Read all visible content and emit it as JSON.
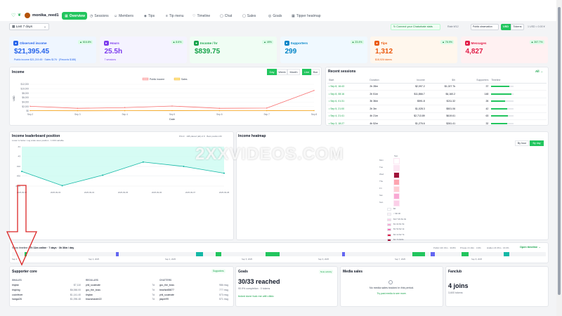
{
  "nav": {
    "username": "monika_reed1",
    "tabs": [
      {
        "label": "Overview",
        "icon": "grid-icon"
      },
      {
        "label": "Sessions",
        "icon": "clock-icon"
      },
      {
        "label": "Members",
        "icon": "users-icon"
      },
      {
        "label": "Tips",
        "icon": "coin-icon"
      },
      {
        "label": "Tip menu",
        "icon": "list-icon"
      },
      {
        "label": "Timeline",
        "icon": "timeline-icon"
      },
      {
        "label": "Chat",
        "icon": "chat-icon"
      },
      {
        "label": "Sales",
        "icon": "cart-icon"
      },
      {
        "label": "Goals",
        "icon": "target-icon"
      },
      {
        "label": "Tipper heatmap",
        "icon": "grid-icon"
      }
    ]
  },
  "toolbar": {
    "range": "Last 7 days",
    "connect": "Connect your Chaturbate stats",
    "rate_label": "Rate ¥/12",
    "rate_value": "Public observation",
    "currency_usd": "USD",
    "currency_tokens": "Tokens",
    "exchange": "1 USD = 0.00 ¥"
  },
  "kpis": [
    {
      "label": "Observed income",
      "value": "$21,395.45",
      "badge": "▲ 616.8%",
      "sub": "Public income $21,219.45 · Sales $176 · (Records $188)",
      "color": "#2563eb",
      "bg": "#eff6ff"
    },
    {
      "label": "Hours",
      "value": "25.5h",
      "badge": "▲ 8.6%",
      "sub": "7 sessions",
      "color": "#7c3aed",
      "bg": "#f5f3ff"
    },
    {
      "label": "Income / hr",
      "value": "$839.75",
      "badge": "▲ 49%",
      "sub": "",
      "color": "#16a34a",
      "bg": "#f0fdf4"
    },
    {
      "label": "Supporters",
      "value": "299",
      "badge": "▲ 23.4%",
      "sub": "",
      "color": "#0284c7",
      "bg": "#f0f9ff"
    },
    {
      "label": "Tips",
      "value": "1,312",
      "badge": "▲ 76.9%",
      "sub": "$18,926 tokens",
      "color": "#ea580c",
      "bg": "#fff7ed"
    },
    {
      "label": "Messages",
      "value": "4,827",
      "badge": "▲ 267.7%",
      "sub": "",
      "color": "#e11d48",
      "bg": "#fff1f2"
    }
  ],
  "income_card": {
    "title": "Income",
    "buttons": [
      "Day",
      "Week",
      "Month",
      "Line",
      "Bar"
    ],
    "legend": [
      "Public income",
      "Sales"
    ],
    "xlabel": "Date",
    "ylabel": "USD"
  },
  "chart_data": {
    "type": "line",
    "title": "Income",
    "xlabel": "Date",
    "ylabel": "USD",
    "categories": [
      "Sep 2",
      "Sep 3",
      "Sep 4",
      "Sep 5",
      "Sep 6",
      "Sep 7",
      "Sep 8"
    ],
    "series": [
      {
        "name": "Public income",
        "values": [
          2100,
          1200,
          1500,
          2200,
          1200,
          1300,
          9200
        ],
        "color": "#f87171"
      },
      {
        "name": "Sales",
        "values": [
          150,
          100,
          120,
          140,
          110,
          130,
          160
        ],
        "color": "#f59e0b"
      }
    ],
    "yticks": [
      "$0",
      "$2,000",
      "$4,000",
      "$6,000",
      "$8,000",
      "$10,000",
      "$12,000"
    ],
    "ylim": [
      0,
      12000
    ]
  },
  "sessions": {
    "title": "Recent sessions",
    "all": "All →",
    "columns": [
      "Start",
      "Duration",
      "Income",
      "$/h",
      "Supporters",
      "Timeline"
    ],
    "rows": [
      {
        "start": "Sep 8, 16:43",
        "duration": "2h 28m",
        "income": "$2,097.2",
        "rate": "$1,027.7k",
        "supporters": "37",
        "fill": 0.8
      },
      {
        "start": "Sep 8, 08:16",
        "duration": "2h 51m",
        "income": "$11,866.7",
        "rate": "$4,160.2",
        "supporters": "148",
        "fill": 0.9
      },
      {
        "start": "Sep 6, 01:31",
        "duration": "3h 36m",
        "income": "$591.8",
        "rate": "$211.32",
        "supporters": "26",
        "fill": 0.6
      },
      {
        "start": "Sep 5, 21:00",
        "duration": "2h 3m",
        "income": "$1,028.3",
        "rate": "$501.06",
        "supporters": "42",
        "fill": 0.7
      },
      {
        "start": "Sep 4, 21:41",
        "duration": "4h 21m",
        "income": "$2,713.89",
        "rate": "$619.61",
        "supporters": "63",
        "fill": 0.75
      },
      {
        "start": "Sep 3, 18:27",
        "duration": "4h 52m",
        "income": "$1,276.6",
        "rate": "$261.41",
        "supporters": "32",
        "fill": 0.7
      }
    ]
  },
  "leaderboard": {
    "title": "Income leaderboard position",
    "subtitle": "Lower is better. Log scale axes position · 1 000 variable",
    "note": "PCLF · 108 placed (all) of # · Best position #3",
    "xticks": [
      "2025-09-02",
      "2025-09-03",
      "2025-09-04",
      "2025-09-05",
      "2025-09-06",
      "2025-09-07",
      "2025-09-08"
    ],
    "yticks": [
      "#1",
      "#3",
      "#10",
      "#30",
      "#100"
    ],
    "values": [
      18,
      95,
      28,
      6,
      10,
      22
    ]
  },
  "heatmap": {
    "title": "Income heatmap",
    "buttons": [
      "By hour",
      "By day"
    ],
    "col": "Sep",
    "days": [
      "Mon",
      "Tue",
      "Wed",
      "Thu",
      "Fri",
      "Sat",
      "Sun"
    ],
    "legend": [
      "$0",
      "< $0.00",
      "$1/7.99 $1.0k",
      "$1.0k $1.5k",
      "$1.5k $2.1k",
      "$2.1k $2.7k",
      "$2.7k $16k"
    ]
  },
  "timeline": {
    "label_prefix": "Show timeline",
    "summary": "27h 11m online · 7 days · 3h 36m / day",
    "legend": [
      "Public 13h 15m · 33.8%",
      "Private 1h 19m · 4.9%",
      "Hidden 4h 35m · 16.9%"
    ],
    "open": "Open timeline →",
    "ticks": [
      "Sep 2",
      "Sep 3, 2025",
      "Sep 4, 2025",
      "Sep 5, 2025",
      "Sep 6, 2025",
      "Sep 7, 2025",
      "Sep 8, 2025"
    ]
  },
  "supporter_core": {
    "title": "Supporter core",
    "badge": "Supporters",
    "whales_head": "WHALES",
    "regulars_head": "REGULARS",
    "chatters_head": "CHATTERS",
    "whales": [
      [
        "tinyfan",
        "$7,110"
      ],
      [
        "tinyking",
        "$6,066.00"
      ],
      [
        "cocinfever",
        "$1,141.40"
      ],
      [
        "hangul26",
        "$1,096.48"
      ]
    ],
    "regulars": [
      [
        "phil_soulmate",
        "7d"
      ],
      [
        "gcc_the_boss",
        "7d"
      ],
      [
        "tinyfan",
        "7d"
      ],
      [
        "bravomaster22",
        "7d"
      ]
    ],
    "chatters": [
      [
        "gcc_the_boss",
        "986 msg"
      ],
      [
        "bearfan55877",
        "777 msg"
      ],
      [
        "phil_soulmate",
        "573 msg"
      ],
      [
        "jasper99",
        "571 msg"
      ]
    ]
  },
  "goals": {
    "title": "Goals",
    "badge": "Note activity",
    "value": "30/33 reached",
    "sub": "90.9% completion · 0 tokens",
    "link": "ticked done fuck me with dildo"
  },
  "media": {
    "title": "Media sales",
    "empty": "No media sales tracked in this period.",
    "link": "Try past media to see more."
  },
  "fanclub": {
    "title": "Fanclub",
    "value": "4 joins",
    "sub": "3,600 tokens"
  },
  "watermark": "2XXVIDEOS.COM"
}
